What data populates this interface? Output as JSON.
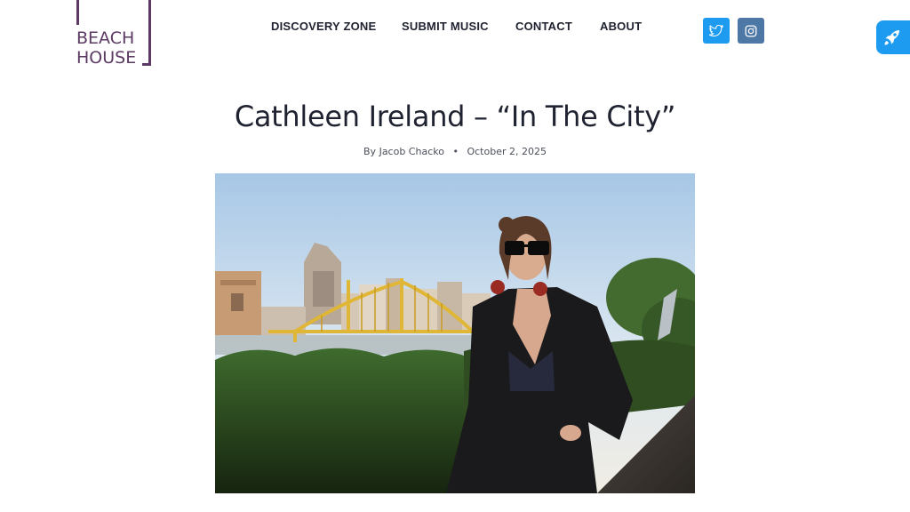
{
  "logo": {
    "line1": "BEACH",
    "line2": "HOUSE"
  },
  "nav": {
    "discovery": "DISCOVERY ZONE",
    "submit": "SUBMIT MUSIC",
    "contact": "CONTACT",
    "about": "ABOUT"
  },
  "social": {
    "twitter_icon": "twitter-icon",
    "instagram_icon": "instagram-icon"
  },
  "floating": {
    "icon": "rocket-icon"
  },
  "post": {
    "title": "Cathleen Ireland – “In The City”",
    "author": "By Jacob Chacko",
    "separator": "•",
    "date": "October 2, 2025"
  },
  "colors": {
    "brand": "#5c3a63",
    "twitter": "#1d9bf0",
    "instagram": "#4d78a5",
    "text": "#1f2230"
  }
}
